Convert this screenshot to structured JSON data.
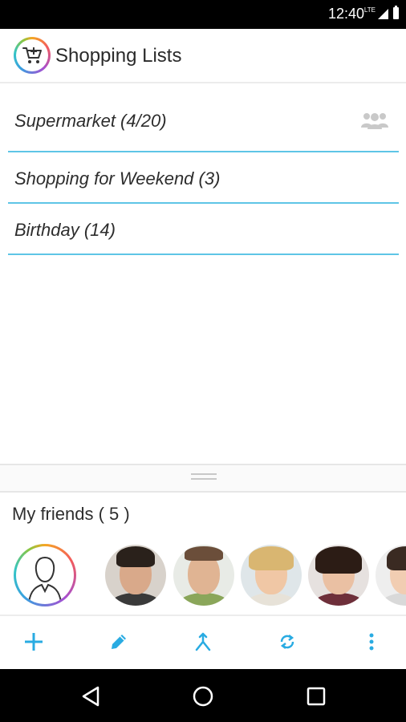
{
  "status_bar": {
    "time": "12:40",
    "network": "LTE",
    "icons": [
      "signal-icon",
      "battery-icon"
    ]
  },
  "app": {
    "title": "Shopping Lists",
    "logo_icon": "cart-icon",
    "accent_color": "#29abe2"
  },
  "lists": [
    {
      "label": "Supermarket (4/20)",
      "shared_icon": "group-icon"
    },
    {
      "label": "Shopping for Weekend (3)"
    },
    {
      "label": "Birthday (14)"
    }
  ],
  "friends": {
    "title": "My friends ( 5 )",
    "avatars": [
      "my-profile-avatar",
      "friend-1",
      "friend-2",
      "friend-3",
      "friend-4",
      "friend-5"
    ]
  },
  "toolbar": {
    "items": [
      "add-icon",
      "edit-icon",
      "merge-icon",
      "sync-icon",
      "more-vertical-icon"
    ]
  },
  "navigation": {
    "items": [
      "back-icon",
      "home-icon",
      "recents-icon"
    ]
  }
}
